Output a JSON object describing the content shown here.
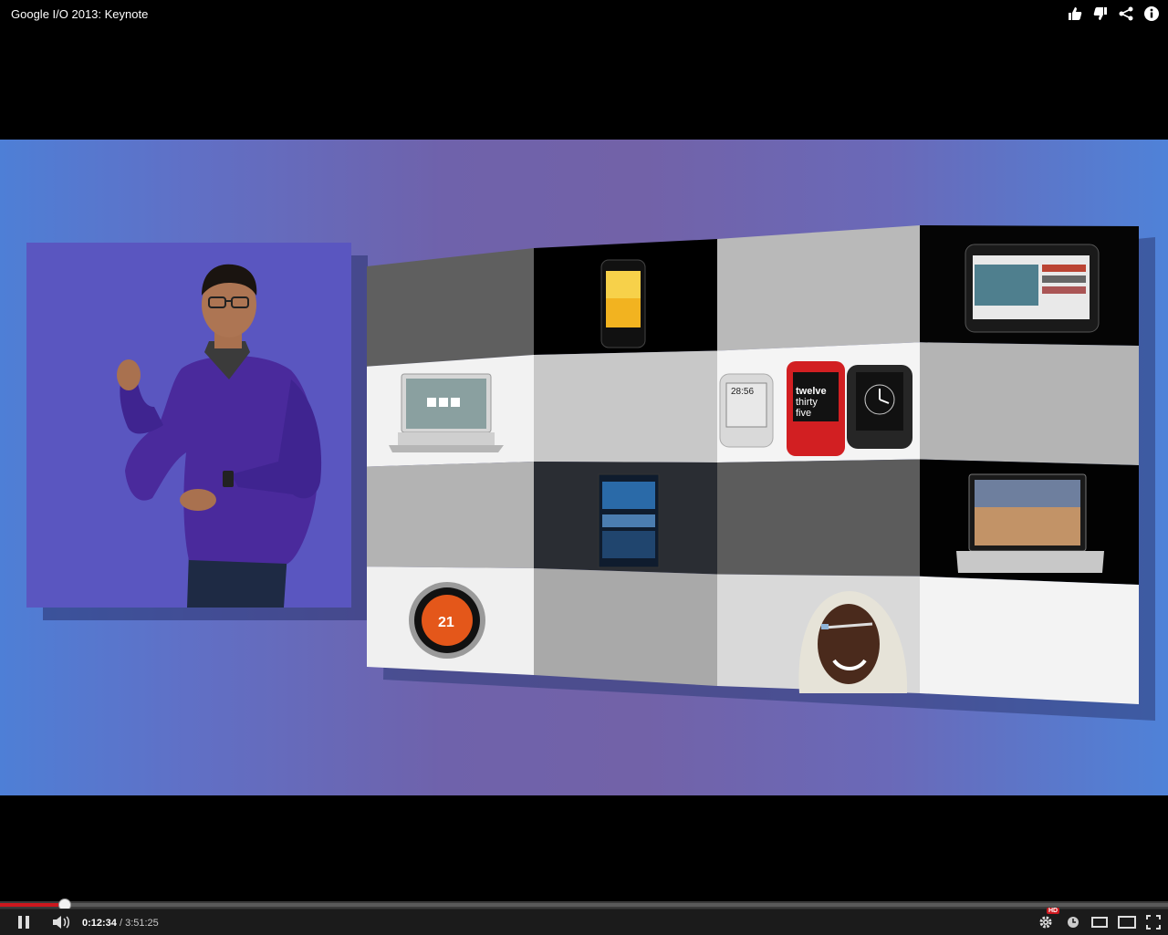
{
  "window": {
    "title": "Google I/O 2013: Keynote"
  },
  "top_actions": [
    {
      "name": "like-icon"
    },
    {
      "name": "dislike-icon"
    },
    {
      "name": "share-icon"
    },
    {
      "name": "info-icon"
    }
  ],
  "slide": {
    "tiles": [
      {
        "row": 0,
        "col": 0,
        "kind": "plain",
        "color": "#5f5f5f"
      },
      {
        "row": 0,
        "col": 1,
        "kind": "phone",
        "color": "#000000"
      },
      {
        "row": 0,
        "col": 2,
        "kind": "plain",
        "color": "#b9b9b9"
      },
      {
        "row": 0,
        "col": 3,
        "kind": "tablet",
        "color": "#050505"
      },
      {
        "row": 1,
        "col": 0,
        "kind": "chromebook",
        "color": "#f2f2f2"
      },
      {
        "row": 1,
        "col": 1,
        "kind": "plain",
        "color": "#c8c8c8"
      },
      {
        "row": 1,
        "col": 2,
        "kind": "watches",
        "color": "#f4f4f4"
      },
      {
        "row": 1,
        "col": 3,
        "kind": "plain",
        "color": "#b4b4b4"
      },
      {
        "row": 2,
        "col": 0,
        "kind": "plain",
        "color": "#b3b3b3"
      },
      {
        "row": 2,
        "col": 1,
        "kind": "car-dashboard",
        "color": "#2a2d33"
      },
      {
        "row": 2,
        "col": 2,
        "kind": "plain",
        "color": "#5c5c5c"
      },
      {
        "row": 2,
        "col": 3,
        "kind": "laptop",
        "color": "#020202"
      },
      {
        "row": 3,
        "col": 0,
        "kind": "thermostat",
        "color": "#f0f0f0"
      },
      {
        "row": 3,
        "col": 1,
        "kind": "plain",
        "color": "#a9a9a9"
      },
      {
        "row": 3,
        "col": 2,
        "kind": "glass-wearer",
        "color": "#d9d9d9"
      },
      {
        "row": 3,
        "col": 3,
        "kind": "plain",
        "color": "#f3f3f3"
      }
    ],
    "watch_face": {
      "time_digital": "28:56",
      "words": [
        "twelve",
        "thirty",
        "five"
      ]
    },
    "thermostat_reading": "21"
  },
  "player": {
    "current_time": "0:12:34",
    "duration": "/ 3:51:25",
    "played_fraction": 0.0543,
    "loaded_fraction": 1.0,
    "hd_label": "HD",
    "accent_color": "#cc181e"
  }
}
